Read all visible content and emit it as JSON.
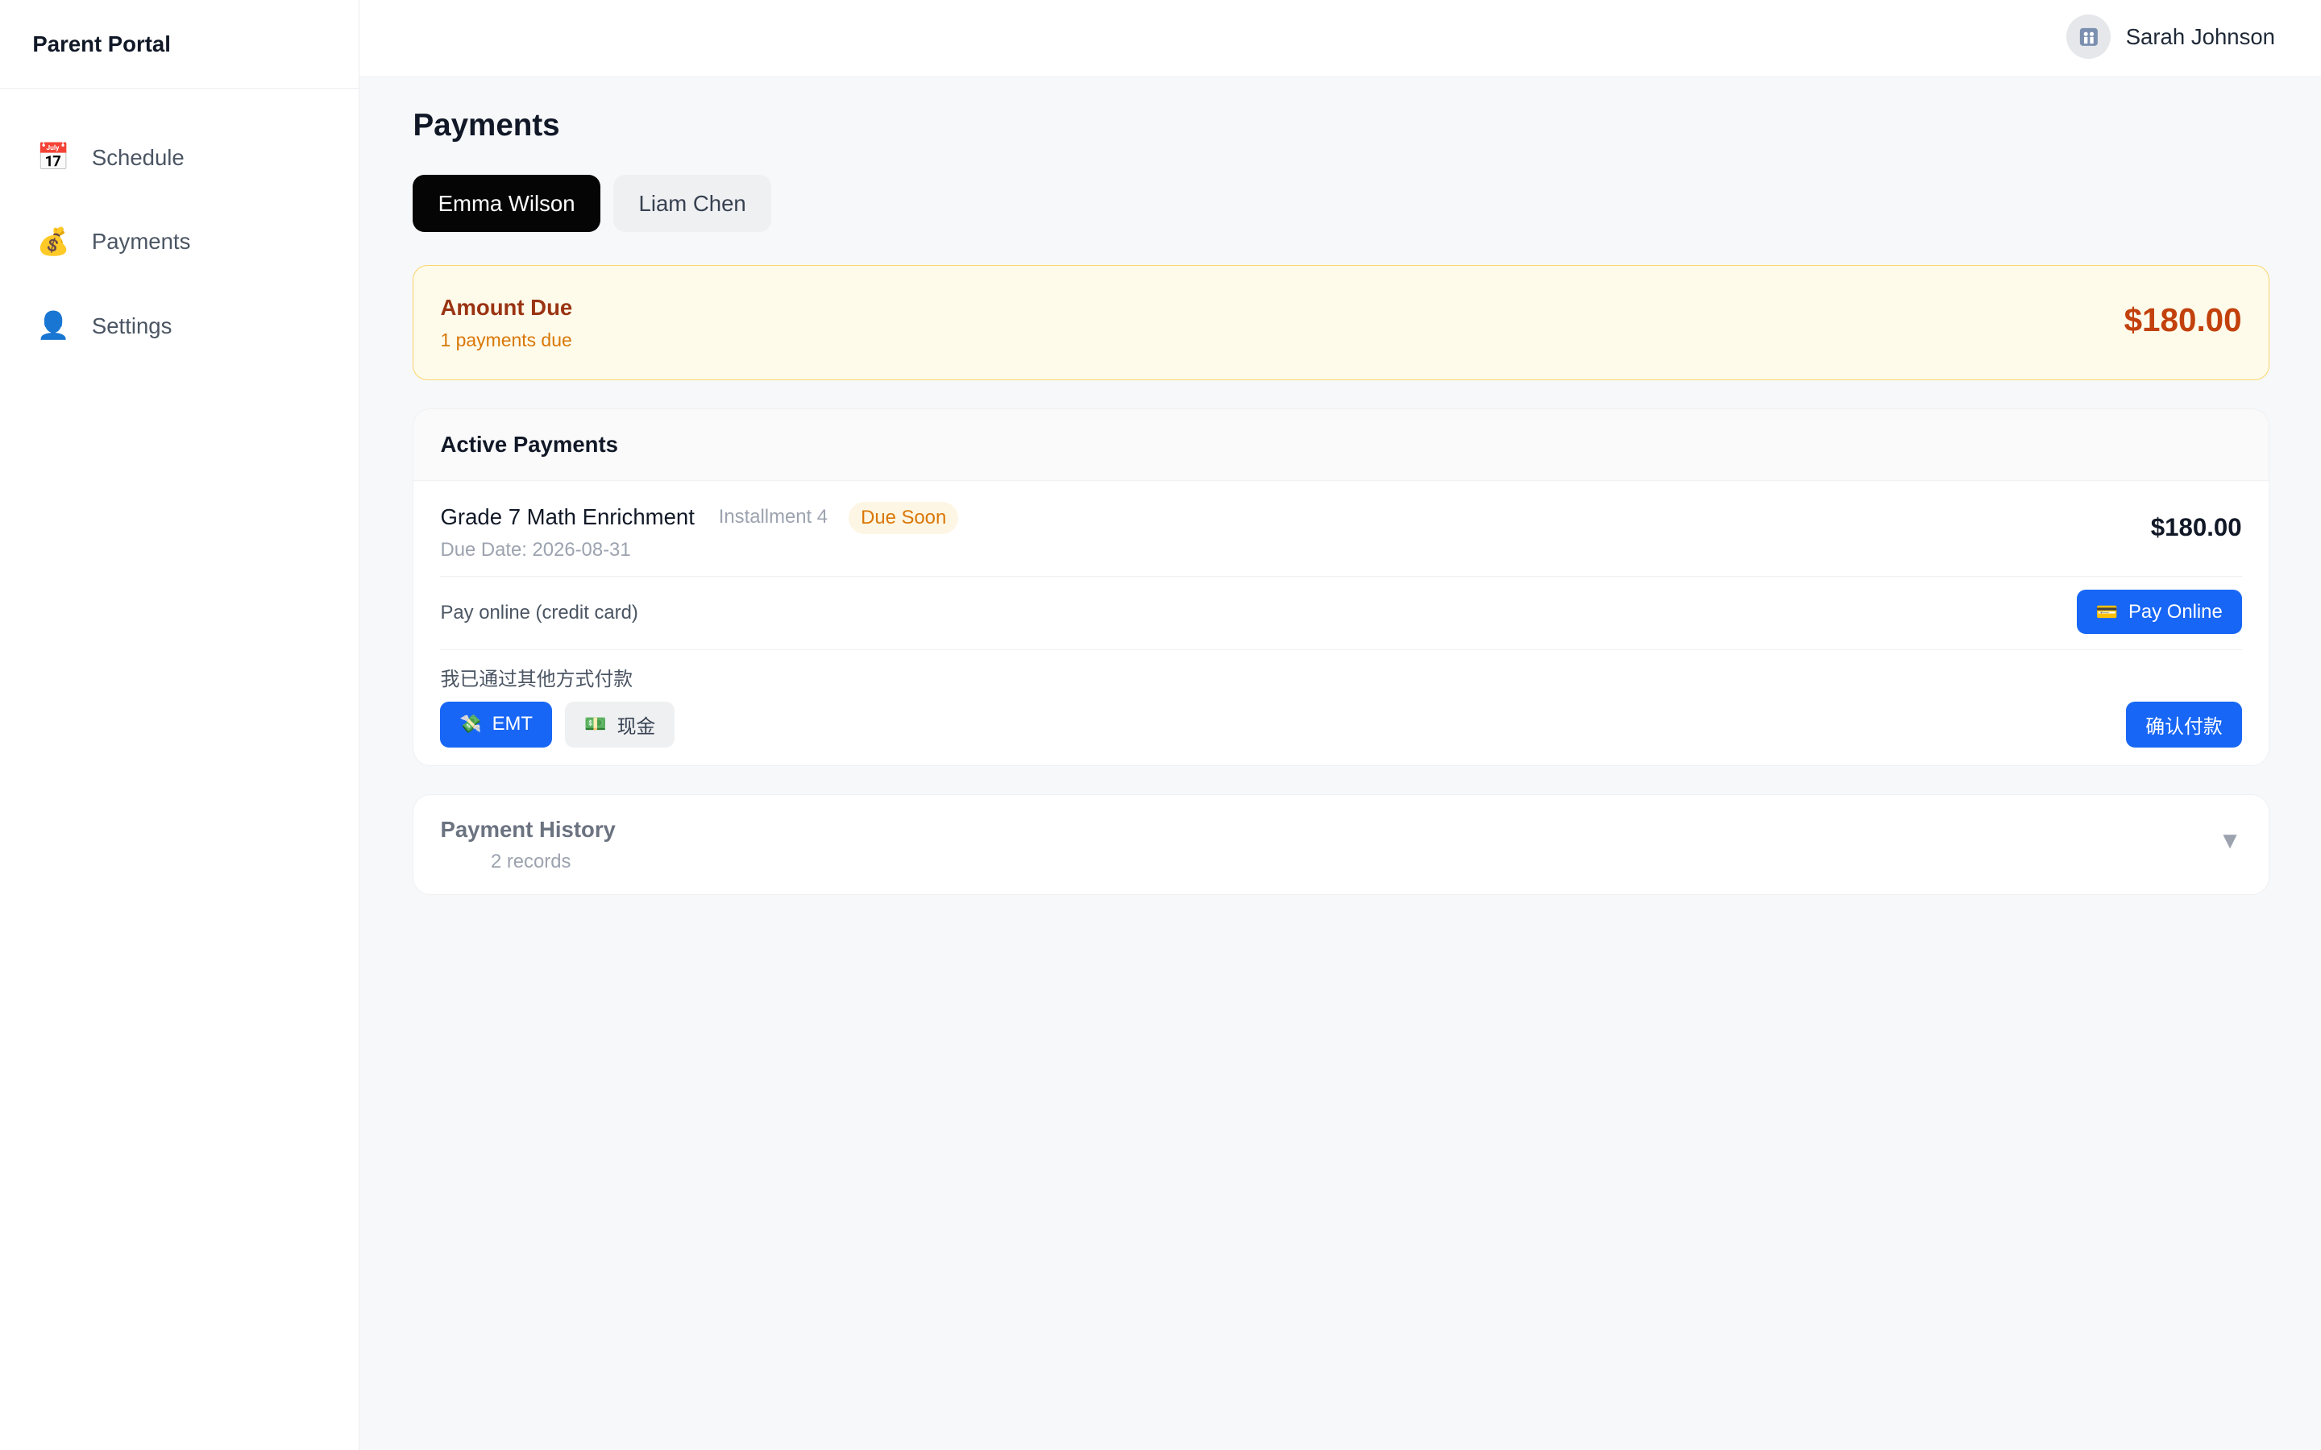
{
  "sidebar": {
    "brand": "Parent Portal",
    "items": [
      {
        "label": "Schedule",
        "icon": "calendar-icon",
        "glyph": "📅"
      },
      {
        "label": "Payments",
        "icon": "money-bag-icon",
        "glyph": "💰"
      },
      {
        "label": "Settings",
        "icon": "user-icon",
        "glyph": "👤"
      }
    ]
  },
  "header": {
    "user_name": "Sarah Johnson",
    "avatar_icon": "parents-icon"
  },
  "main": {
    "title": "Payments",
    "tabs": [
      {
        "label": "Emma Wilson",
        "active": true
      },
      {
        "label": "Liam Chen",
        "active": false
      }
    ],
    "amount_due": {
      "title": "Amount Due",
      "subtitle": "1 payments due",
      "amount": "$180.00"
    },
    "active_payments": {
      "title": "Active Payments",
      "item": {
        "course": "Grade 7 Math Enrichment",
        "installment": "Installment 4",
        "status": "Due Soon",
        "due_date": "Due Date: 2026-08-31",
        "amount": "$180.00"
      },
      "online": {
        "label": "Pay online (credit card)",
        "button_label": "Pay Online",
        "button_icon": "credit-card-icon"
      },
      "other": {
        "label": "我已通过其他方式付款",
        "methods": [
          {
            "label": "EMT",
            "icon": "money-wings-icon",
            "selected": true
          },
          {
            "label": "现金",
            "icon": "cash-icon",
            "selected": false
          }
        ],
        "confirm_label": "确认付款"
      }
    },
    "history": {
      "title": "Payment History",
      "subtitle": "2 records",
      "chevron": "▼"
    }
  },
  "colors": {
    "primary": "#1766f5",
    "warning_bg": "#fefbeb",
    "warning_border": "#fbd56b",
    "warning_text": "#c2410c",
    "badge_text": "#d97706"
  }
}
